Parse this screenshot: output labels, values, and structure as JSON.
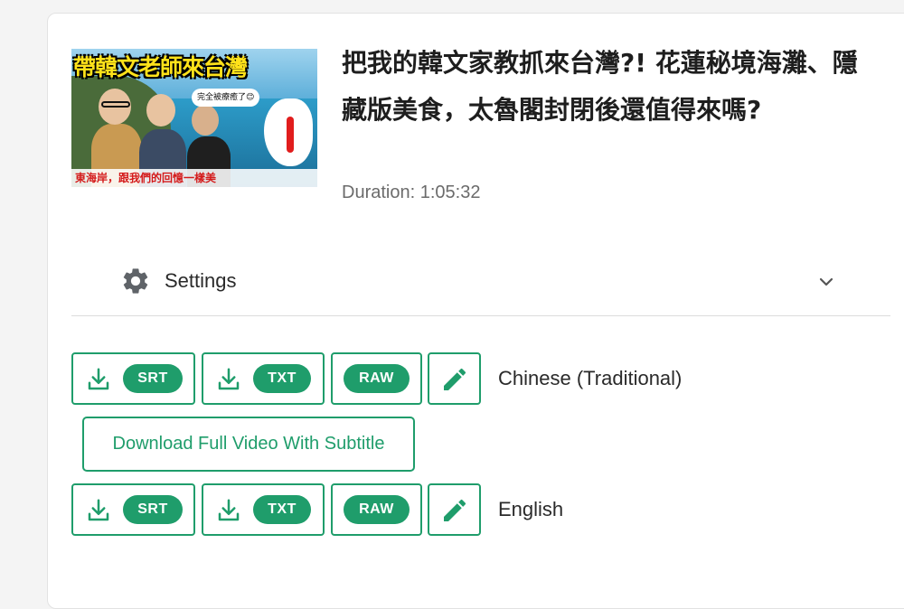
{
  "video": {
    "thumbnail": {
      "title_text": "帶韓文老師來台灣",
      "bubble_text": "完全被療癒了😊",
      "bottom_caption": "東海岸，跟我們的回憶一樣美"
    },
    "title": "把我的韓文家教抓來台灣?! 花蓮秘境海灘、隱藏版美食，太魯閣封閉後還值得來嗎?",
    "duration": "Duration: 1:05:32"
  },
  "settings": {
    "label": "Settings",
    "icon": "gear-icon",
    "toggle_icon": "chevron-down-icon"
  },
  "subtitles": [
    {
      "language": "Chinese (Traditional)",
      "srt_label": "SRT",
      "txt_label": "TXT",
      "raw_label": "RAW"
    },
    {
      "language": "English",
      "srt_label": "SRT",
      "txt_label": "TXT",
      "raw_label": "RAW"
    }
  ],
  "full_video_button": "Download Full Video With Subtitle",
  "colors": {
    "accent": "#1f9d6b",
    "page_background": "#f4f4f4",
    "card_background": "#ffffff"
  }
}
